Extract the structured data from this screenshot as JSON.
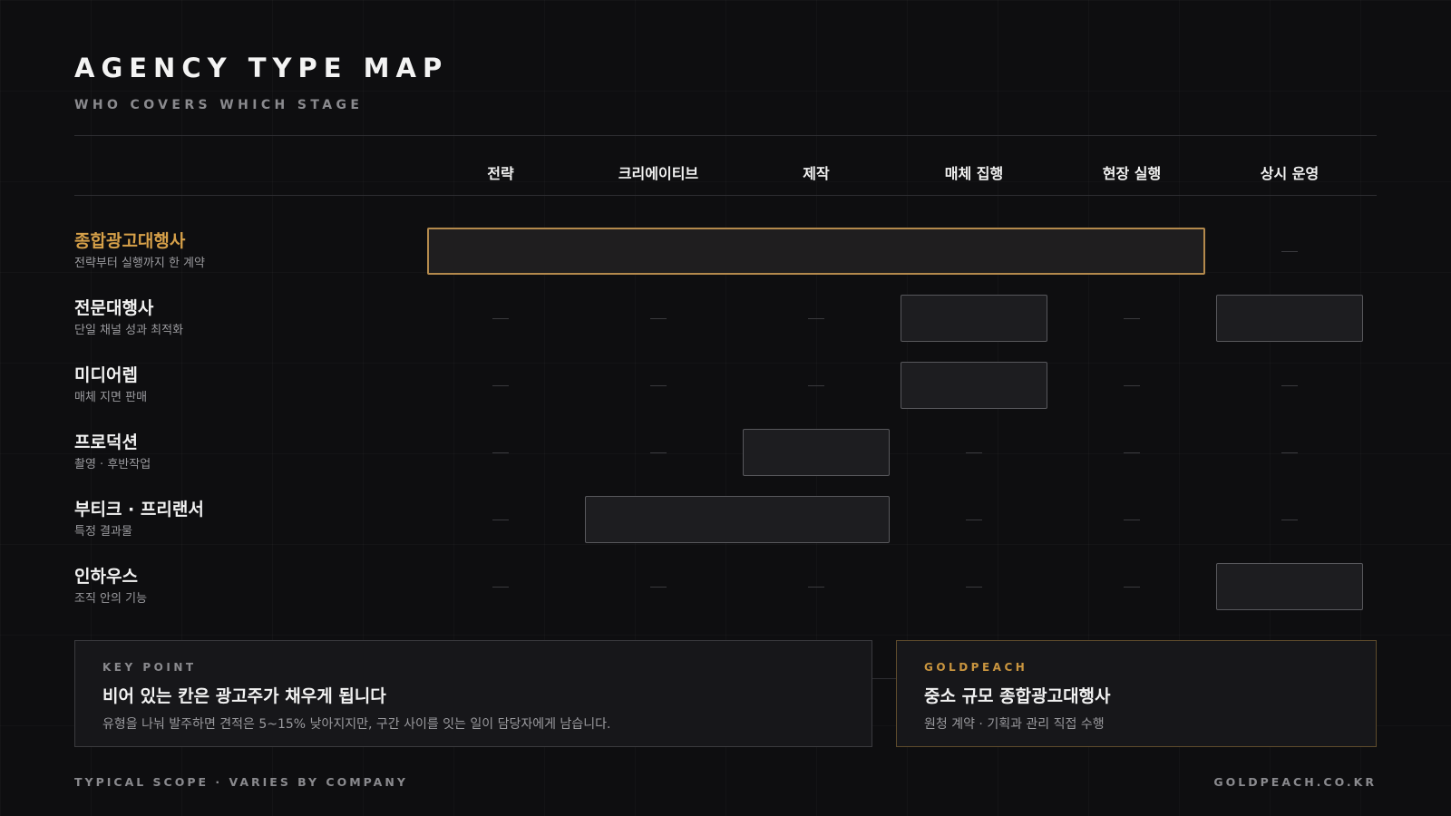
{
  "header": {
    "title": "AGENCY TYPE MAP",
    "subtitle": "WHO COVERS WHICH STAGE"
  },
  "columns": [
    "전략",
    "크리에이티브",
    "제작",
    "매체 집행",
    "현장 실행",
    "상시 운영"
  ],
  "rows": [
    {
      "name": "종합광고대행사",
      "desc": "전략부터 실행까지 한 계약",
      "highlight": true,
      "covered": [
        true,
        true,
        true,
        true,
        true,
        false
      ]
    },
    {
      "name": "전문대행사",
      "desc": "단일 채널 성과 최적화",
      "highlight": false,
      "covered": [
        false,
        false,
        false,
        true,
        false,
        true
      ]
    },
    {
      "name": "미디어렙",
      "desc": "매체 지면 판매",
      "highlight": false,
      "covered": [
        false,
        false,
        false,
        true,
        false,
        false
      ]
    },
    {
      "name": "프로덕션",
      "desc": "촬영 · 후반작업",
      "highlight": false,
      "covered": [
        false,
        false,
        true,
        false,
        false,
        false
      ]
    },
    {
      "name": "부티크 · 프리랜서",
      "desc": "특정 결과물",
      "highlight": false,
      "covered": [
        false,
        true,
        true,
        false,
        false,
        false
      ]
    },
    {
      "name": "인하우스",
      "desc": "조직 안의 기능",
      "highlight": false,
      "covered": [
        false,
        false,
        false,
        false,
        false,
        true
      ]
    }
  ],
  "key_point": {
    "kicker": "KEY POINT",
    "headline": "비어 있는 칸은 광고주가 채우게 됩니다",
    "body": "유형을 나눠 발주하면 견적은 5~15% 낮아지지만, 구간 사이를 잇는 일이 담당자에게 남습니다."
  },
  "brand_card": {
    "kicker": "GOLDPEACH",
    "headline": "중소 규모 종합광고대행사",
    "body": "원청 계약 · 기획과 관리 직접 수행"
  },
  "footer": {
    "left": "TYPICAL SCOPE · VARIES BY COMPANY",
    "right": "GOLDPEACH.CO.KR"
  },
  "colors": {
    "background": "#0e0e10",
    "accent_gold": "#d6a049",
    "bar_fill": "#1d1d20",
    "bar_border": "#58585c"
  }
}
